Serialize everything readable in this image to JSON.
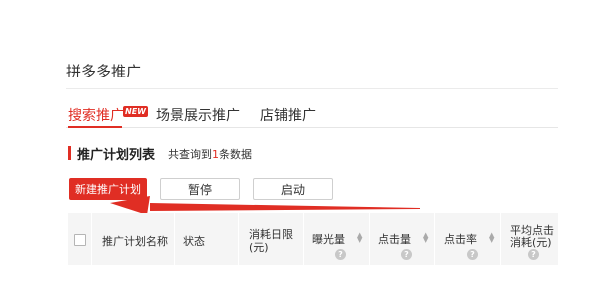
{
  "page": {
    "title": "拼多多推广"
  },
  "tabs": [
    {
      "label": "搜索推广",
      "badge": "NEW",
      "active": true
    },
    {
      "label": "场景展示推广",
      "active": false
    },
    {
      "label": "店铺推广",
      "active": false
    }
  ],
  "section": {
    "title": "推广计划列表",
    "count_prefix": "共查询到",
    "count": "1",
    "count_suffix": "条数据"
  },
  "toolbar": {
    "create_label": "新建推广计划",
    "pause_label": "暂停",
    "start_label": "启动"
  },
  "table": {
    "columns": [
      {
        "label": "推广计划名称"
      },
      {
        "label": "状态"
      },
      {
        "label_line1": "消耗日限",
        "label_line2": "(元)"
      },
      {
        "label": "曝光量",
        "sortable": true,
        "help": true
      },
      {
        "label": "点击量",
        "sortable": true,
        "help": true
      },
      {
        "label": "点击率",
        "sortable": true,
        "help": true
      },
      {
        "label_line1": "平均点击",
        "label_line2": "消耗(元)",
        "help": true
      }
    ]
  },
  "icons": {
    "help": "question-mark-icon",
    "sort": "sort-arrows-icon",
    "annotation": "red-arrow-annotation"
  },
  "colors": {
    "accent": "#e02e24",
    "table_header_bg": "#f5f5f5"
  }
}
